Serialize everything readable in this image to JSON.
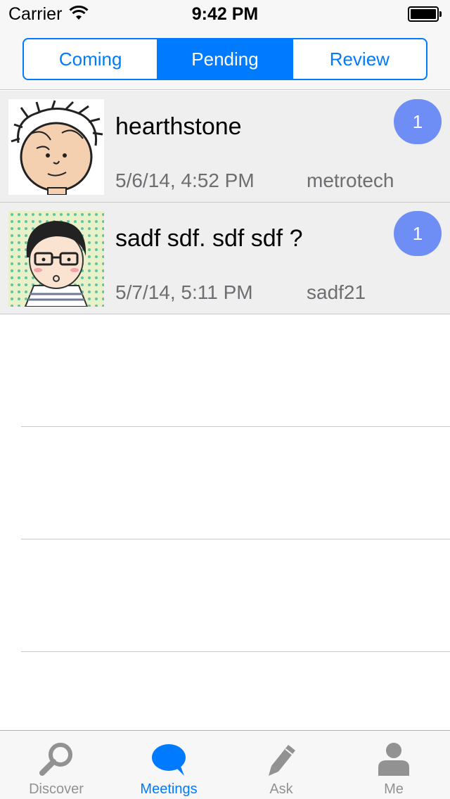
{
  "status_bar": {
    "carrier": "Carrier",
    "time": "9:42 PM"
  },
  "segments": [
    {
      "label": "Coming",
      "active": false
    },
    {
      "label": "Pending",
      "active": true
    },
    {
      "label": "Review",
      "active": false
    }
  ],
  "meetings": [
    {
      "title": "hearthstone",
      "date": "5/6/14, 4:52 PM",
      "user": "metrotech",
      "badge": "1",
      "avatar": "cartoon-boy-avatar"
    },
    {
      "title": "sadf sdf. sdf sdf ?",
      "date": "5/7/14, 5:11 PM",
      "user": "sadf21",
      "badge": "1",
      "avatar": "cartoon-glasses-avatar"
    }
  ],
  "tabbar": [
    {
      "label": "Discover",
      "icon": "magnifier-icon",
      "active": false
    },
    {
      "label": "Meetings",
      "icon": "chat-bubble-icon",
      "active": true
    },
    {
      "label": "Ask",
      "icon": "pencil-icon",
      "active": false
    },
    {
      "label": "Me",
      "icon": "person-icon",
      "active": false
    }
  ],
  "colors": {
    "accent": "#007aff",
    "badge": "#6e8ef5",
    "row_background": "#efefef",
    "tab_inactive": "#929292"
  }
}
